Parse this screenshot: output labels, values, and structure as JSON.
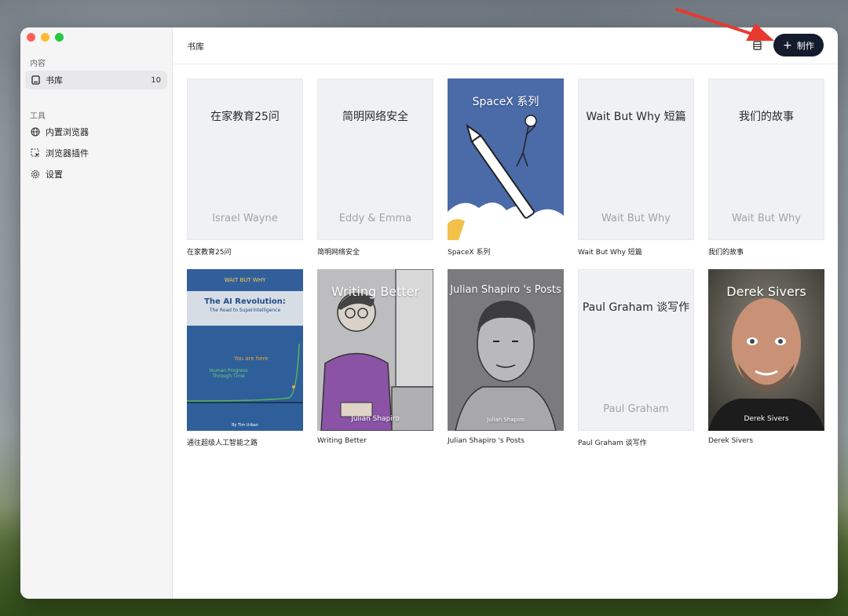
{
  "sidebar": {
    "section_content": "内容",
    "section_tools": "工具",
    "library": {
      "label": "书库",
      "count": "10"
    },
    "tools": [
      {
        "label": "内置浏览器",
        "icon": "globe-icon"
      },
      {
        "label": "浏览器插件",
        "icon": "plugin-icon"
      },
      {
        "label": "设置",
        "icon": "gear-icon"
      }
    ]
  },
  "header": {
    "title": "书库",
    "create_label": "制作",
    "create_icon": "plus"
  },
  "books": [
    {
      "label": "在家教育25问",
      "cover_title": "在家教育25问",
      "cover_author": "Israel Wayne"
    },
    {
      "label": "简明网络安全",
      "cover_title": "简明网络安全",
      "cover_author": "Eddy & Emma"
    },
    {
      "label": "SpaceX 系列",
      "cover_title": "SpaceX 系列"
    },
    {
      "label": "Wait But Why 短篇",
      "cover_title": "Wait But Why 短篇",
      "cover_author": "Wait But Why"
    },
    {
      "label": "我们的故事",
      "cover_title": "我们的故事",
      "cover_author": "Wait But Why"
    },
    {
      "label": "通往超级人工智能之路",
      "cover_brand": "WAIT BUT WHY",
      "cover_title": "The AI Revolution:",
      "cover_subtitle": "The Road to Superintelligence",
      "cover_you": "You are here",
      "cover_progress": "Human Progress Through Time",
      "cover_by": "By Tim Urban"
    },
    {
      "label": "Writing Better",
      "cover_title": "Writing Better",
      "cover_author": "Julian Shapiro"
    },
    {
      "label": "Julian Shapiro 's Posts",
      "cover_title": "Julian Shapiro 's Posts",
      "cover_author": "Julian Shapiro"
    },
    {
      "label": "Paul Graham 谈写作",
      "cover_title": "Paul Graham 谈写作",
      "cover_author": "Paul Graham"
    },
    {
      "label": "Derek Sivers",
      "cover_title": "Derek Sivers",
      "cover_author": "Derek Sivers"
    }
  ],
  "colors": {
    "accent": "#141b2d",
    "annotation_arrow": "#e8392f"
  }
}
